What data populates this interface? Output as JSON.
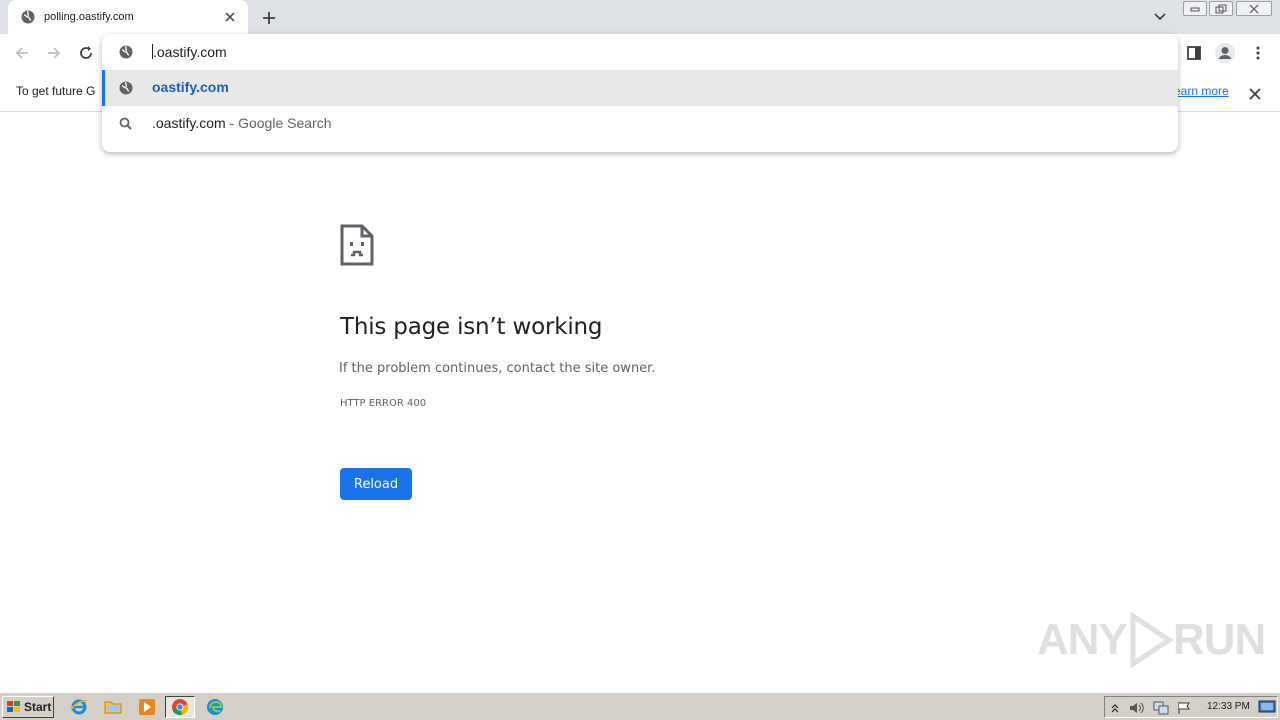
{
  "browser": {
    "tab": {
      "title": "polling.oastify.com",
      "favicon": "globe-icon"
    },
    "new_tab_icon": "plus-icon"
  },
  "omnibox": {
    "input_value": ".oastify.com",
    "suggestions": [
      {
        "text": "oastify.com",
        "suffix": "",
        "icon": "globe-icon",
        "selected": true
      },
      {
        "text": ".oastify.com",
        "suffix": " - Google Search",
        "icon": "search-icon",
        "selected": false
      }
    ]
  },
  "infobar": {
    "message": "To get future G",
    "link": "earn more"
  },
  "error_page": {
    "heading": "This page isn’t working",
    "message": "If the problem continues, contact the site owner.",
    "code": "HTTP ERROR 400",
    "reload_label": "Reload"
  },
  "watermark": {
    "left": "ANY",
    "right": "RUN"
  },
  "taskbar": {
    "start_label": "Start",
    "clock": "12:33 PM"
  },
  "colors": {
    "accent": "#1a73e8",
    "tabstrip": "#dee1e6",
    "taskbar": "#d4d0c8"
  }
}
